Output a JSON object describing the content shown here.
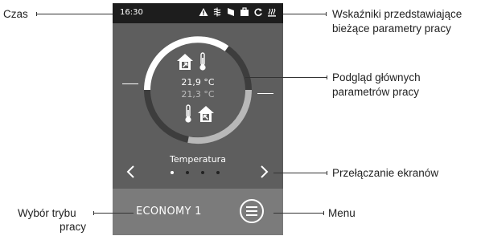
{
  "statusbar": {
    "time": "16:30",
    "icons": [
      "warning-icon",
      "defrost-icon",
      "filter-icon",
      "boost-icon",
      "recirculation-icon",
      "heater-icon"
    ]
  },
  "main": {
    "value_primary": "21,9 °C",
    "value_secondary": "21,3 °C",
    "top_icons": [
      "house-supply-icon",
      "thermometer-icon"
    ],
    "bottom_icons": [
      "thermometer-icon",
      "house-extract-icon"
    ],
    "screen_title": "Temperatura",
    "pager": {
      "count": 4,
      "active": 1
    }
  },
  "bottombar": {
    "mode_label": "ECONOMY 1",
    "menu_icon": "menu-icon"
  },
  "annotations": {
    "time": "Czas",
    "indicators_line1": "Wskaźniki przedstawiające",
    "indicators_line2": "bieżące parametry pracy",
    "preview_line1": "Podgląd głównych",
    "preview_line2": "parametrów pracy",
    "switch_screens": "Przełączanie ekranów",
    "mode_line1": "Wybór trybu",
    "mode_line2": "pracy",
    "menu": "Menu"
  },
  "colors": {
    "device_bg": "#5e5e5e",
    "statusbar_bg": "#1d1d1d",
    "bottombar_bg": "#7b7b7b",
    "ring_light": "#ffffff",
    "ring_dark": "#3d3d3d",
    "ring_grey": "#b8b8b8"
  }
}
